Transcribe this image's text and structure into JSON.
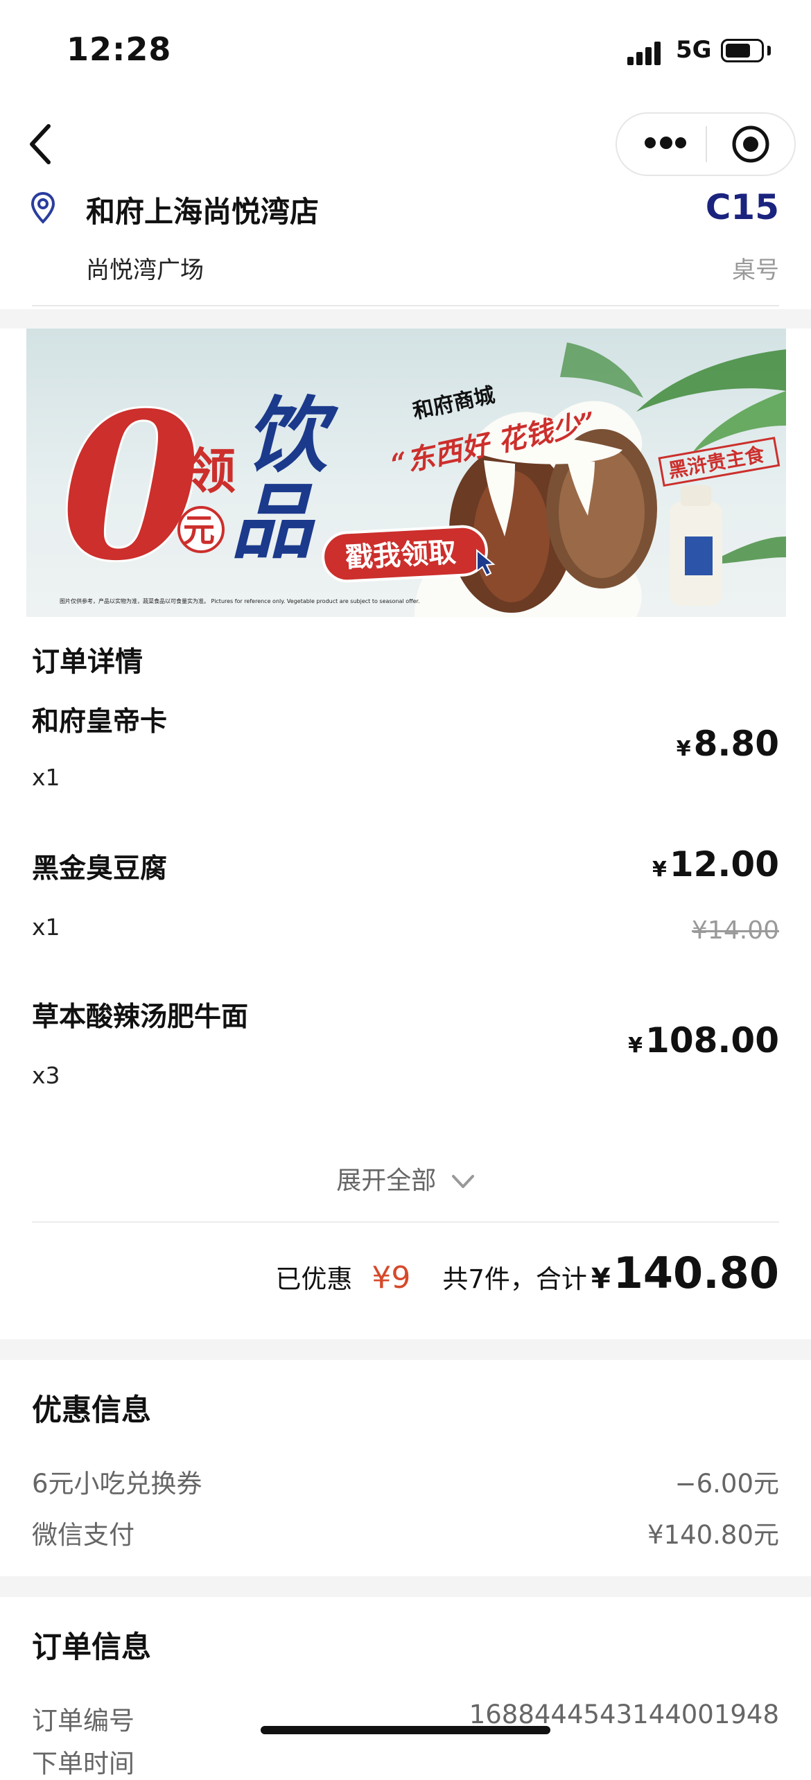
{
  "status_bar": {
    "time": "12:28",
    "network": "5G",
    "battery_level": 0.72
  },
  "store": {
    "name": "和府上海尚悦湾店",
    "sub": "尚悦湾广场",
    "table_no": "C15",
    "table_label": "桌号"
  },
  "banner": {
    "zero": "0",
    "yuan": "元",
    "ling": "领",
    "drink_top": "饮",
    "drink_bottom": "品",
    "brand": "和府商城",
    "slogan": "“东西好 花钱少”",
    "cta": "戳我领取",
    "stamp": "黑浒贵主食",
    "footnote": "图片仅供参考，产品以实物为准，蔬菜食品以可食量实为准。 Pictures for reference only. Vegetable product are subject to seasonal offer."
  },
  "order": {
    "title": "订单详情",
    "items": [
      {
        "name": "和府皇帝卡",
        "qty": "x1",
        "yen": "¥",
        "price": "8.80"
      },
      {
        "name": "黑金臭豆腐",
        "qty": "x1",
        "yen": "¥",
        "price": "12.00",
        "original_price": "¥14.00"
      },
      {
        "name": "草本酸辣汤肥牛面",
        "qty": "x3",
        "yen": "¥",
        "price": "108.00"
      }
    ],
    "expand_label": "展开全部",
    "summary": {
      "discount_label": "已优惠",
      "discount_value": "¥9",
      "count_label": "共7件，合计",
      "total_yen": "¥",
      "total": "140.80"
    }
  },
  "discount_info": {
    "title": "优惠信息",
    "rows": [
      {
        "label": "6元小吃兑换券",
        "value": "−6.00元"
      },
      {
        "label": "微信支付",
        "value": "¥140.80元"
      }
    ]
  },
  "order_info": {
    "title": "订单信息",
    "rows": [
      {
        "label": "订单编号",
        "value": "1688444543144001948"
      },
      {
        "label": "下单时间",
        "value": ""
      }
    ]
  },
  "colors": {
    "accent_red": "#d6492a",
    "table_no": "#1a237e",
    "banner_red": "#cc2f2c",
    "banner_blue": "#1b3a8c"
  }
}
